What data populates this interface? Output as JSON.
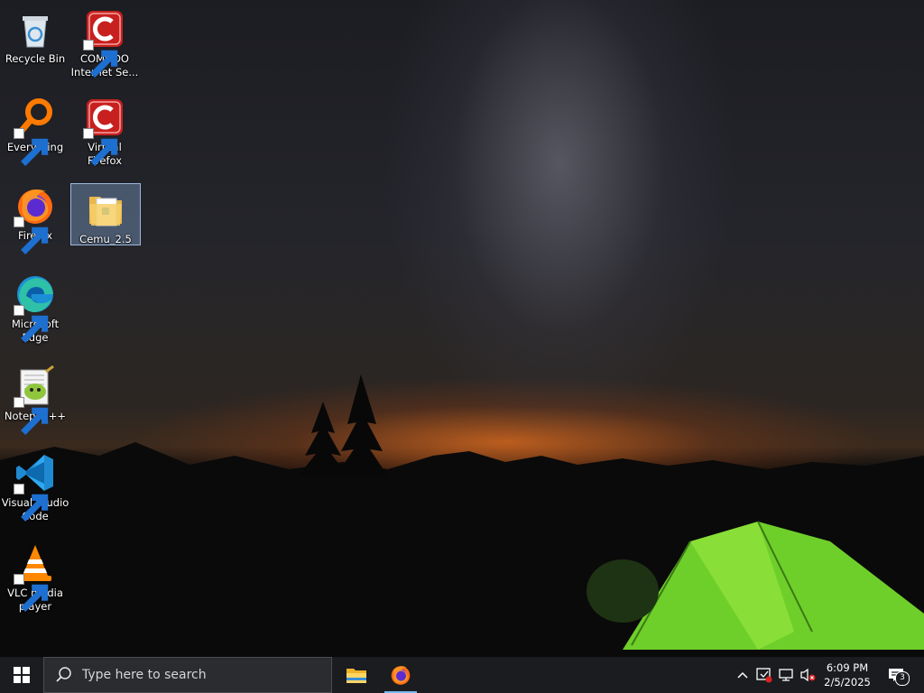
{
  "desktop": {
    "icons": [
      {
        "label": "Recycle Bin",
        "icon": "recycle-bin-icon"
      },
      {
        "label": "COMODO Internet Se...",
        "icon": "comodo-icon"
      },
      {
        "label": "Everything",
        "icon": "everything-search-icon"
      },
      {
        "label": "Virtual Firefox",
        "icon": "comodo-virtual-icon"
      },
      {
        "label": "Firefox",
        "icon": "firefox-icon"
      },
      {
        "label": "Cemu_2.5",
        "icon": "folder-icon"
      },
      {
        "label": "Microsoft Edge",
        "icon": "edge-icon"
      },
      {
        "label": "Notepad++",
        "icon": "notepadpp-icon"
      },
      {
        "label": "Visual Studio Code",
        "icon": "vscode-icon"
      },
      {
        "label": "VLC media player",
        "icon": "vlc-icon"
      }
    ],
    "selected_icon": "Cemu_2.5"
  },
  "taskbar": {
    "search_placeholder": "Type here to search",
    "pinned": [
      {
        "name": "File Explorer",
        "icon": "file-explorer-icon",
        "active": false
      },
      {
        "name": "Firefox",
        "icon": "firefox-icon",
        "active": true
      }
    ],
    "clock": {
      "time": "6:09 PM",
      "date": "2/5/2025"
    },
    "notifications_count": "3"
  },
  "colors": {
    "taskbar_bg": "#1a1c20",
    "active_indicator": "#76b9ed",
    "selection": "#7896be"
  }
}
